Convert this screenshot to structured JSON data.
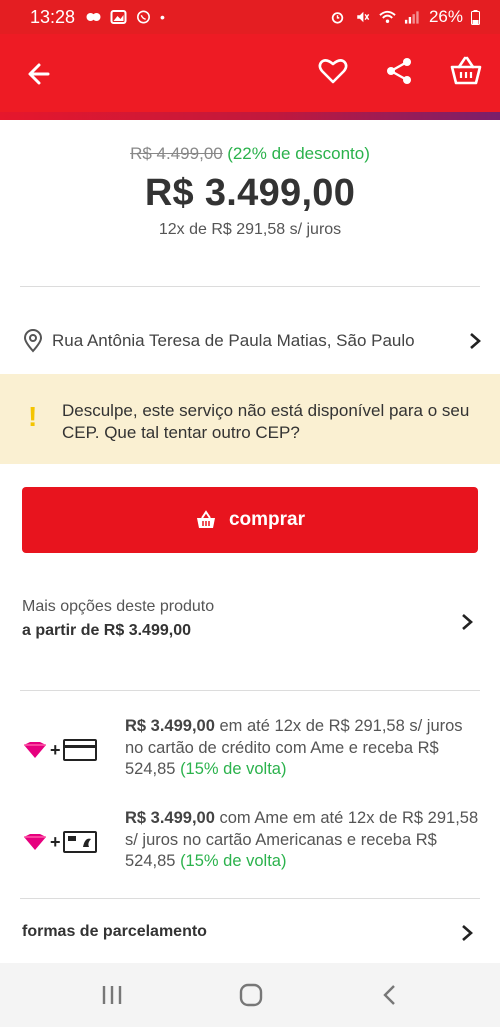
{
  "status_bar": {
    "time": "13:28",
    "battery": "26%"
  },
  "app_bar": {
    "icons": [
      "back-arrow-icon",
      "heart-icon",
      "share-icon",
      "basket-icon"
    ]
  },
  "product": {
    "old_price": "R$ 4.499,00",
    "discount": "(22% de desconto)",
    "price": "R$ 3.499,00",
    "installments": "12x de R$ 291,58 s/ juros"
  },
  "shipping": {
    "address": "Rua Antônia Teresa de Paula Matias, São Paulo",
    "warning_line1": "Desculpe, este serviço não está disponível para o seu",
    "warning_line2": "CEP. Que tal tentar outro CEP?"
  },
  "buy_button": {
    "label": "comprar"
  },
  "more_options": {
    "line1": "Mais opções deste produto",
    "line2": "a partir de R$ 3.499,00"
  },
  "payments": [
    {
      "price": "R$ 3.499,00",
      "text": " em até 12x de R$ 291,58 s/ juros no cartão de crédito  com Ame e receba R$ 524,85 ",
      "cashback": "(15% de volta)"
    },
    {
      "price": "R$ 3.499,00",
      "text": " com Ame em até 12x de R$ 291,58 s/ juros no cartão Americanas  e receba R$ 524,85 ",
      "cashback": "(15% de volta)"
    }
  ],
  "formas": {
    "label": "formas de parcelamento"
  },
  "colors": {
    "brand_red": "#e8141e",
    "discount_green": "#2bb24c",
    "warning_bg": "#faf0d2",
    "warning_icon": "#f4c400"
  }
}
